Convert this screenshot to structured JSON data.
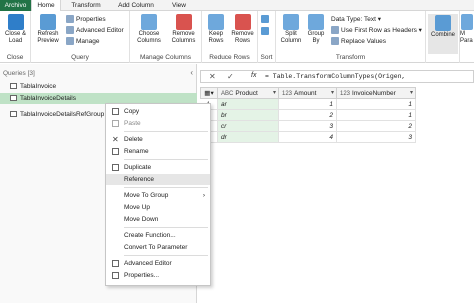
{
  "tabs": [
    "Archivo",
    "Home",
    "Transform",
    "Add Column",
    "View"
  ],
  "ribbon": {
    "close_group": {
      "label": "Close",
      "close_load": "Close & Load"
    },
    "query_group": {
      "label": "Query",
      "refresh": "Refresh Preview",
      "properties": "Properties",
      "advanced_editor": "Advanced Editor",
      "manage": "Manage"
    },
    "manage_columns_group": {
      "label": "Manage Columns",
      "choose": "Choose Columns",
      "remove": "Remove Columns"
    },
    "reduce_rows_group": {
      "label": "Reduce Rows",
      "keep": "Keep Rows",
      "remove": "Remove Rows"
    },
    "sort_group": {
      "label": "Sort"
    },
    "transform_group": {
      "label": "Transform",
      "split": "Split Column",
      "group_by": "Group By",
      "data_type": "Data Type: Text",
      "first_row": "Use First Row as Headers",
      "replace": "Replace Values"
    },
    "combine_group": {
      "combine": "Combine",
      "mi": "M",
      "para": "Para"
    }
  },
  "queries": {
    "title": "Queries [3]",
    "collapse": "‹",
    "items": [
      "TablaInvoice",
      "TablaInvoiceDetails",
      "TablaInvoiceDetailsRefGroup"
    ]
  },
  "formula": {
    "cancel": "✕",
    "commit": "✓",
    "fx": "fx",
    "text": "= Table.TransformColumnTypes(Origen,"
  },
  "grid": {
    "columns": [
      {
        "type": "ABC",
        "name": "Product"
      },
      {
        "type": "123",
        "name": "Amount"
      },
      {
        "type": "123",
        "name": "InvoiceNumber"
      }
    ],
    "rows": [
      {
        "n": "1",
        "product": "ar",
        "amount": "1",
        "invoice": "1"
      },
      {
        "n": "2",
        "product": "br",
        "amount": "2",
        "invoice": "1"
      },
      {
        "n": "3",
        "product": "cr",
        "amount": "3",
        "invoice": "2"
      },
      {
        "n": "4",
        "product": "dr",
        "amount": "4",
        "invoice": "3"
      }
    ]
  },
  "context_menu": {
    "items": [
      "Copy",
      "Paste",
      "Delete",
      "Rename",
      "Duplicate",
      "Reference",
      "Move To Group",
      "Move Up",
      "Move Down",
      "Create Function...",
      "Convert To Parameter",
      "Advanced Editor",
      "Properties..."
    ]
  },
  "colors": {
    "accent": "#217346",
    "selection": "#bfe2c6",
    "column_highlight": "#e4f3e6"
  }
}
